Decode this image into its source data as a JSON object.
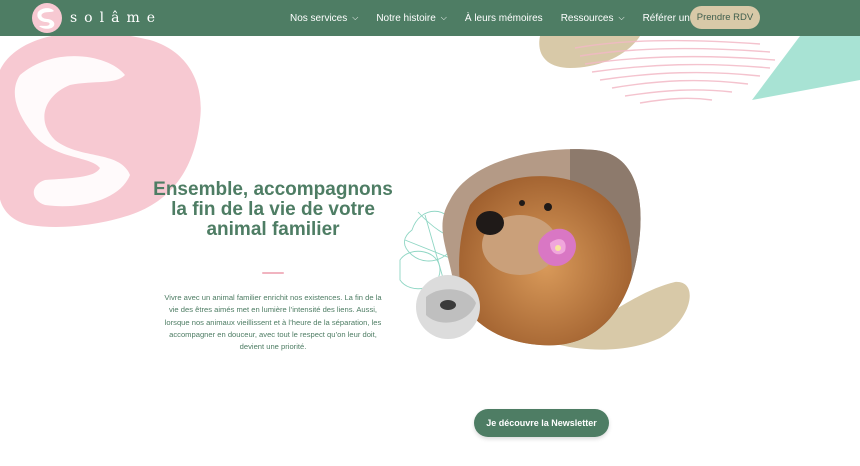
{
  "brand": {
    "name": "solâme",
    "logo_icon": "solame-s-logo-icon"
  },
  "nav": {
    "items": [
      {
        "label": "Nos services",
        "has_dropdown": true
      },
      {
        "label": "Notre histoire",
        "has_dropdown": true
      },
      {
        "label": "À leurs mémoires",
        "has_dropdown": false
      },
      {
        "label": "Ressources",
        "has_dropdown": true
      },
      {
        "label": "Référer un cas",
        "has_dropdown": false
      }
    ],
    "cta_label": "Prendre RDV"
  },
  "hero": {
    "title": "Ensemble, accompagnons la fin de la vie de votre animal familier",
    "body": "Vivre avec un animal familier enrichit nos existences. La fin de la vie des êtres aimés met en lumière l’intensité des liens. Aussi, lorsque nos animaux vieillissent et à l’heure de la séparation, les accompagner en douceur, avec tout le respect qu’on leur doit, devient une priorité.",
    "image": "dog-with-flower-photo"
  },
  "newsletter": {
    "label": "Je découvre la Newsletter"
  },
  "colors": {
    "header_green": "#4e7d64",
    "accent_beige": "#d8c9a8",
    "pink": "#f7c9d2",
    "mint": "#a8e3d4",
    "text_green": "#4e7d64"
  }
}
